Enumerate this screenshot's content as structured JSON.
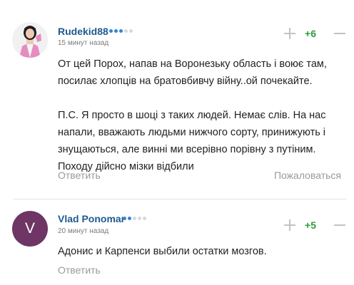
{
  "comments": [
    {
      "author": "Rudekid88",
      "rating_dots": [
        true,
        true,
        true,
        false,
        false
      ],
      "time": "15 минут назад",
      "score": "+6",
      "paragraphs": [
        "От цей Порох, напав на Воронезьку область і воює там, посилає хлопців на братовбивчу війну..ой почекайте.",
        "П.С. Я просто в шоці з таких людей. Немає слів. На нас напали, вважають людьми нижчого сорту, принижують і знущаються, але винні ми всерівно порівну з путіним. Походу дійсно мізки відбили"
      ],
      "reply_label": "Ответить",
      "report_label": "Пожаловаться",
      "avatar": {
        "type": "image",
        "desc": "avatar-photo"
      }
    },
    {
      "author": "Vlad Ponomar",
      "rating_dots": [
        true,
        true,
        false,
        false,
        false
      ],
      "time": "20 минут назад",
      "score": "+5",
      "paragraphs": [
        "Адонис и Карпенси выбили остатки мозгов."
      ],
      "reply_label": "Ответить",
      "avatar": {
        "type": "letter",
        "letter": "V",
        "color": "#6e3565"
      }
    }
  ],
  "colors": {
    "author": "#1f5a8e",
    "score": "#2e9b3c",
    "muted": "#9a9a9a",
    "rating_on": "#2f86d3",
    "rating_off": "#d6dadf"
  }
}
